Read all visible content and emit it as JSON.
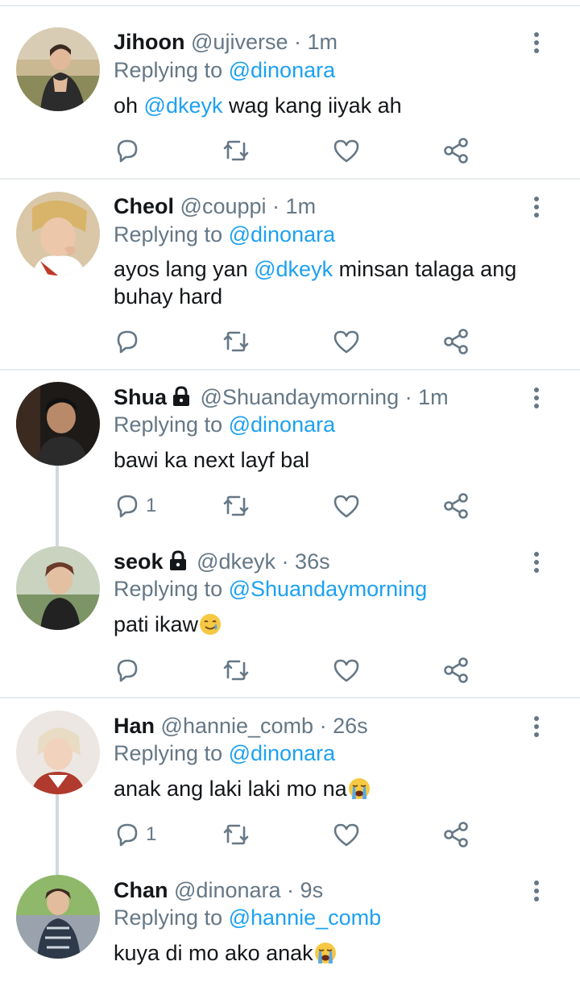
{
  "reply_prefix": "Replying to",
  "tweets": [
    {
      "name": "Jihoon",
      "handle": "@ujiverse",
      "separator": "·",
      "time": "1m",
      "reply_to": "@dinonara",
      "text_before": "oh ",
      "text_mention": "@dkeyk",
      "text_after": " wag kang iiyak ah",
      "reply_count": "",
      "locked": false
    },
    {
      "name": "Cheol",
      "handle": "@couppi",
      "separator": "·",
      "time": "1m",
      "reply_to": "@dinonara",
      "text_before": "ayos lang yan ",
      "text_mention": "@dkeyk",
      "text_after": " minsan talaga ang buhay hard",
      "reply_count": "",
      "locked": false
    },
    {
      "name": "Shua",
      "handle": "@Shuandaymorning",
      "separator": "·",
      "time": "1m",
      "reply_to": "@dinonara",
      "text_before": "bawi ka next layf bal",
      "text_mention": "",
      "text_after": "",
      "reply_count": "1",
      "locked": true
    },
    {
      "name": "seok",
      "handle": "@dkeyk",
      "separator": "·",
      "time": "36s",
      "reply_to": "@Shuandaymorning",
      "text_before": "pati ikaw",
      "text_mention": "",
      "text_after": "",
      "emoji": "smiling-face-with-tear",
      "reply_count": "",
      "locked": true
    },
    {
      "name": "Han",
      "handle": "@hannie_comb",
      "separator": "·",
      "time": "26s",
      "reply_to": "@dinonara",
      "text_before": "anak ang laki laki mo na",
      "text_mention": "",
      "text_after": "",
      "emoji": "loudly-crying-face",
      "reply_count": "1",
      "locked": false
    },
    {
      "name": "Chan",
      "handle": "@dinonara",
      "separator": "·",
      "time": "9s",
      "reply_to": "@hannie_comb",
      "text_before": "kuya di mo ako anak",
      "text_mention": "",
      "text_after": "",
      "emoji": "loudly-crying-face",
      "reply_count": "",
      "locked": false
    }
  ],
  "colors": {
    "link": "#1da1f2",
    "secondary": "#657786",
    "divider": "#e6ecf0",
    "thread": "#cfd9de"
  },
  "icons": [
    "reply-icon",
    "retweet-icon",
    "like-icon",
    "share-icon",
    "more-icon",
    "lock-icon"
  ]
}
